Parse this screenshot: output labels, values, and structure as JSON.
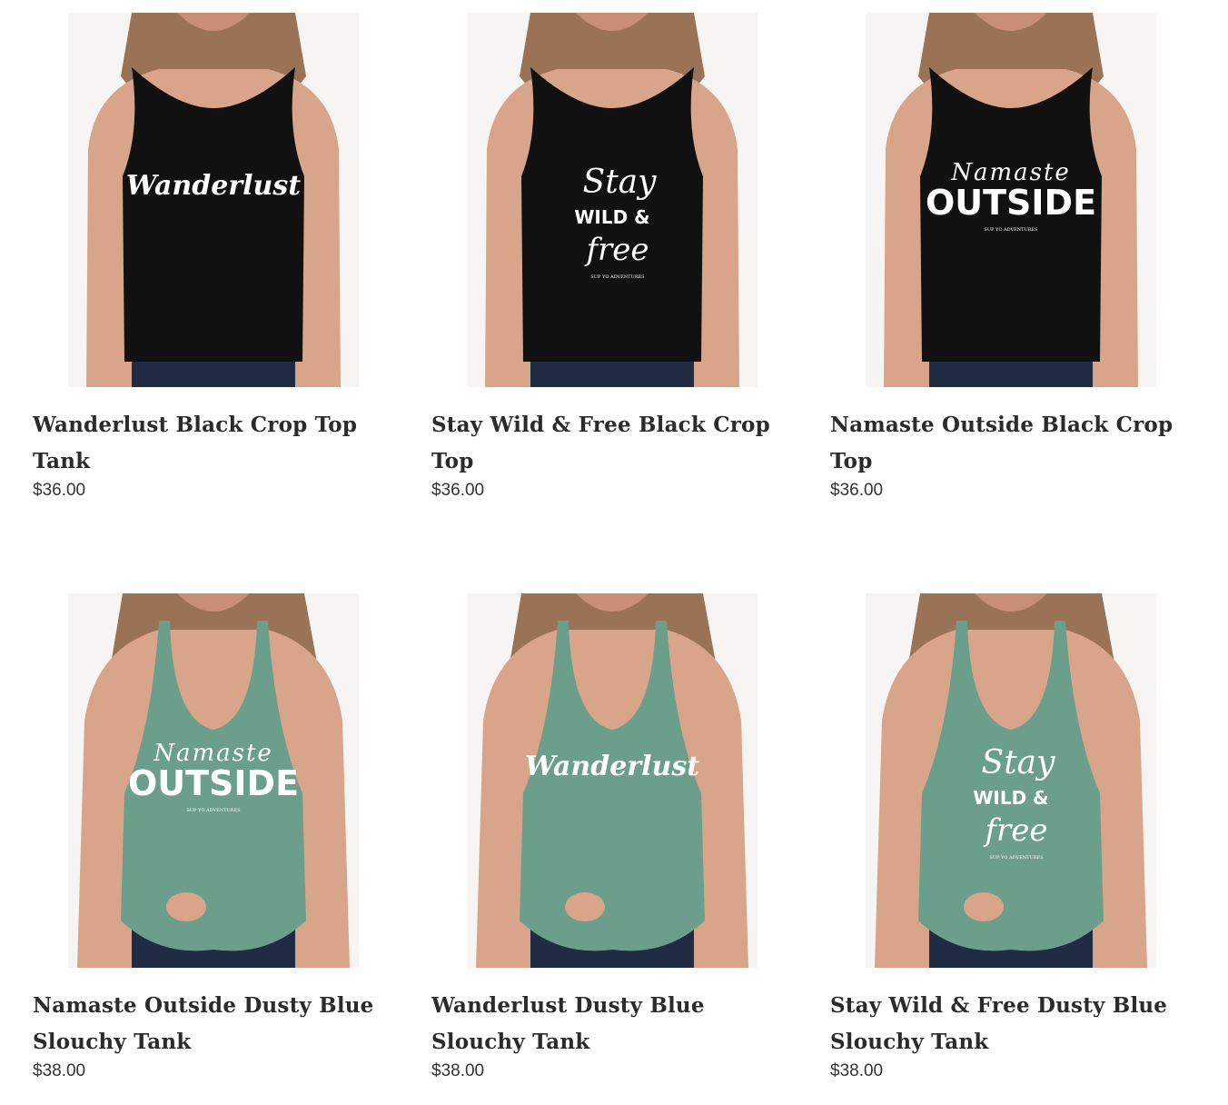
{
  "colors": {
    "black_top": "#111111",
    "dusty_blue_top": "#6b9f8b",
    "skin": "#d9a58a",
    "hair": "#8a5a3a",
    "jeans": "#1f2c44",
    "print": "#ffffff"
  },
  "products": [
    {
      "title": "Wanderlust Black Crop Top Tank",
      "price": "$36.00",
      "style": "black-crop",
      "print_lines": [
        "Wanderlust"
      ],
      "image_icon": "wanderlust-print-icon"
    },
    {
      "title": "Stay Wild & Free Black Crop Top",
      "price": "$36.00",
      "style": "black-crop",
      "print_lines": [
        "Stay",
        "WILD &",
        "free",
        "SUP YO ADVENTURES"
      ],
      "image_icon": "stay-wild-free-print-icon"
    },
    {
      "title": "Namaste Outside Black Crop Top",
      "price": "$36.00",
      "style": "black-crop",
      "print_lines": [
        "Namaste",
        "OUTSIDE",
        "SUP YO ADVENTURES"
      ],
      "image_icon": "namaste-outside-print-icon"
    },
    {
      "title": "Namaste Outside Dusty Blue Slouchy Tank",
      "price": "$38.00",
      "style": "dusty-blue-slouchy",
      "print_lines": [
        "Namaste",
        "OUTSIDE",
        "SUP YO ADVENTURES"
      ],
      "image_icon": "namaste-outside-print-icon"
    },
    {
      "title": "Wanderlust Dusty Blue Slouchy Tank",
      "price": "$38.00",
      "style": "dusty-blue-slouchy",
      "print_lines": [
        "Wanderlust"
      ],
      "image_icon": "wanderlust-print-icon"
    },
    {
      "title": "Stay Wild & Free Dusty Blue Slouchy Tank",
      "price": "$38.00",
      "style": "dusty-blue-slouchy",
      "print_lines": [
        "Stay",
        "WILD &",
        "free",
        "SUP YO ADVENTURES"
      ],
      "image_icon": "stay-wild-free-print-icon"
    }
  ]
}
